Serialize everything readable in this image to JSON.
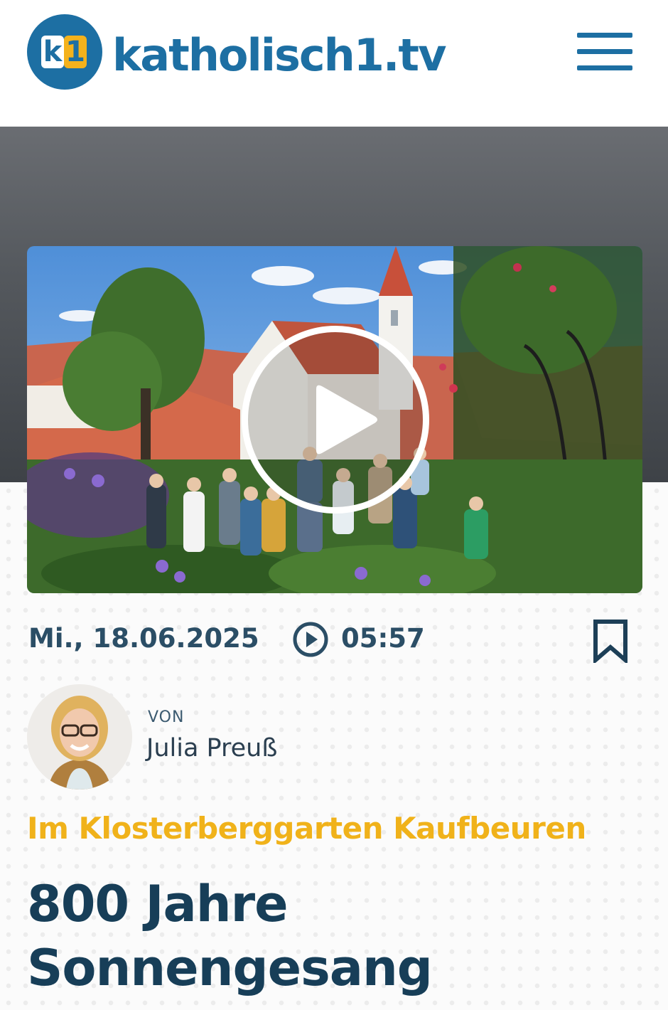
{
  "header": {
    "logo_mark": {
      "left": "k",
      "right": "1"
    },
    "site_name": "katholisch1.tv"
  },
  "colors": {
    "brand_blue": "#1d6fa3",
    "brand_yellow": "#f4b21c",
    "kicker_yellow": "#f0b21a",
    "headline_navy": "#173e58"
  },
  "icons": {
    "menu": "hamburger-menu-icon",
    "play": "play-icon",
    "duration": "play-circle-icon",
    "bookmark": "bookmark-icon"
  },
  "article": {
    "date": "Mi., 18.06.2025",
    "duration": "05:57",
    "author_prefix": "VON",
    "author_name": "Julia Preuß",
    "kicker": "Im Klosterberggarten Kaufbeuren",
    "title_line1": "800 Jahre",
    "title_line2": "Sonnengesang"
  }
}
